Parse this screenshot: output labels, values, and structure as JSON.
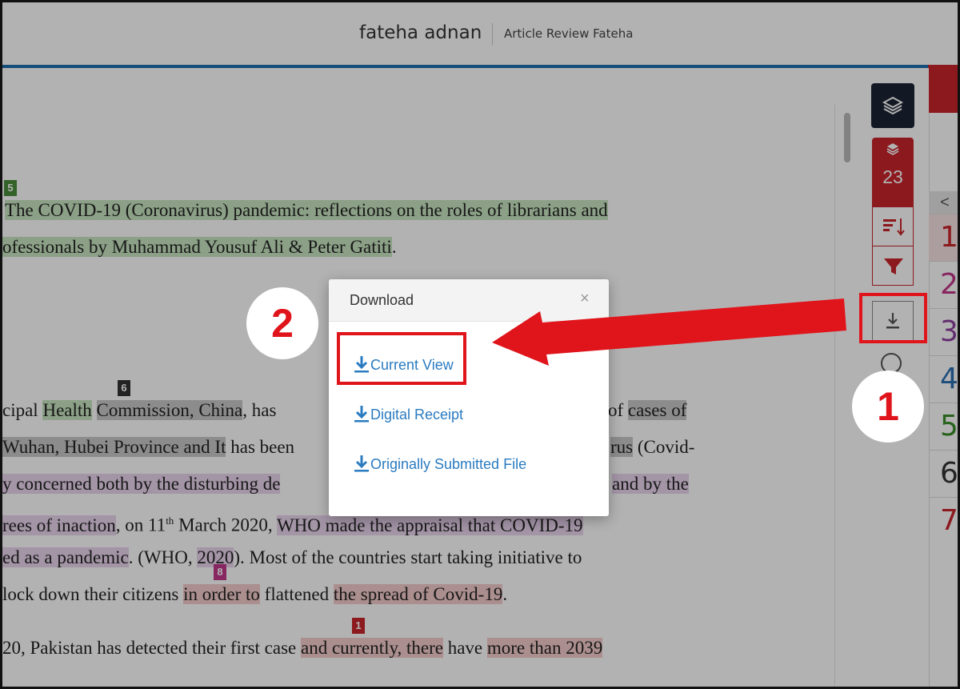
{
  "header": {
    "owner_name": "fateha adnan",
    "assignment_title": "Article Review Fateha"
  },
  "document": {
    "line1": [
      {
        "t": "The COVID-19 (Coronavirus) pandemic: reflections on the roles of librarians and",
        "h": "g"
      }
    ],
    "line2": [
      {
        "t": "ofessionals by Muhammad Yousuf Ali & Peter Gatiti",
        "h": "g"
      },
      {
        "t": ".",
        "h": ""
      }
    ],
    "line3": [
      {
        "t": "cipal ",
        "h": ""
      },
      {
        "t": "Health",
        "h": "g"
      },
      {
        "t": " ",
        "h": ""
      },
      {
        "t": "Commission, China",
        "h": "gray"
      },
      {
        "t": ", has",
        "h": ""
      }
    ],
    "line3_right": [
      {
        "t": "of ",
        "h": ""
      },
      {
        "t": "cases of",
        "h": "gray"
      }
    ],
    "line4": [
      {
        "t": "Wuhan, Hubei Province and It",
        "h": "gray"
      },
      {
        "t": " has been",
        "h": ""
      }
    ],
    "line4_right": [
      {
        "t": "rus",
        "h": "gray"
      },
      {
        "t": " (Covid-",
        "h": ""
      }
    ],
    "line5": [
      {
        "t": "y concerned both by the disturbing de",
        "h": "p"
      }
    ],
    "line5_right": [
      {
        "t": "and by the",
        "h": "p"
      }
    ],
    "line6_parts": {
      "a": "rees of inaction",
      "b": ", on 11",
      "sup": "th",
      "c": " March 2020, ",
      "d": "WHO made the appraisal that COVID-19"
    },
    "line7": [
      {
        "t": "ed as a pandemic",
        "h": "p"
      },
      {
        "t": ". (WHO, ",
        "h": ""
      },
      {
        "t": "2020",
        "h": "p"
      },
      {
        "t": "). Most of the countries start taking initiative to",
        "h": ""
      }
    ],
    "line8": [
      {
        "t": " lock down their citizens ",
        "h": ""
      },
      {
        "t": "in order to",
        "h": "r"
      },
      {
        "t": " flattened ",
        "h": ""
      },
      {
        "t": "the spread of Covid-19",
        "h": "r"
      },
      {
        "t": ".",
        "h": ""
      }
    ],
    "line9": [
      {
        "t": "20, Pakistan has detected their first case ",
        "h": ""
      },
      {
        "t": "and currently, there",
        "h": "r"
      },
      {
        "t": " have ",
        "h": ""
      },
      {
        "t": "more than 2039",
        "h": "r"
      }
    ],
    "badges": {
      "b5": "5",
      "b6": "6",
      "b8": "8",
      "b1": "1"
    }
  },
  "toolbar": {
    "match_count": "23"
  },
  "match_panel": {
    "rows": [
      {
        "num": "1",
        "color": "#c9252c"
      },
      {
        "num": "2",
        "color": "#c2378a"
      },
      {
        "num": "3",
        "color": "#8e3fa0"
      },
      {
        "num": "4",
        "color": "#2a6fb0"
      },
      {
        "num": "5",
        "color": "#3a8f2a"
      },
      {
        "num": "6",
        "color": "#333333"
      },
      {
        "num": "7",
        "color": "#c9252c"
      }
    ]
  },
  "dialog": {
    "title": "Download",
    "close_symbol": "×",
    "options": [
      "Current View",
      "Digital Receipt",
      "Originally Submitted File"
    ]
  },
  "annotations": {
    "step1": "1",
    "step2": "2"
  },
  "colors": {
    "accent_red": "#e0141b",
    "link_blue": "#2a7bc0",
    "brand_red": "#c9252c"
  }
}
